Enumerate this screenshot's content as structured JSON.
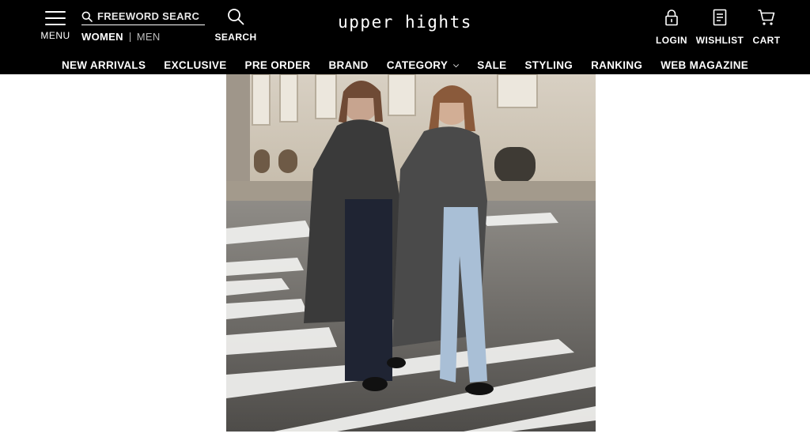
{
  "header": {
    "menu_label": "MENU",
    "search_placeholder": "FREEWORD SEARCH",
    "gender": {
      "women": "WOMEN",
      "men": "MEN"
    },
    "search_label": "SEARCH",
    "logo": "upper hights",
    "login_label": "LOGIN",
    "wishlist_label": "WISHLIST",
    "cart_label": "CART"
  },
  "nav": [
    {
      "label": "NEW ARRIVALS"
    },
    {
      "label": "EXCLUSIVE"
    },
    {
      "label": "PRE ORDER"
    },
    {
      "label": "BRAND"
    },
    {
      "label": "CATEGORY",
      "dropdown": true
    },
    {
      "label": "SALE"
    },
    {
      "label": "STYLING"
    },
    {
      "label": "RANKING"
    },
    {
      "label": "WEB MAGAZINE"
    }
  ],
  "colors": {
    "header_bg": "#000000",
    "header_text": "#ffffff",
    "muted": "#bdbdbd"
  },
  "icons": {
    "menu": "hamburger-icon",
    "search": "magnifier-icon",
    "login": "lock-icon",
    "wishlist": "document-list-icon",
    "cart": "shopping-cart-icon",
    "category": "chevron-down-icon"
  }
}
